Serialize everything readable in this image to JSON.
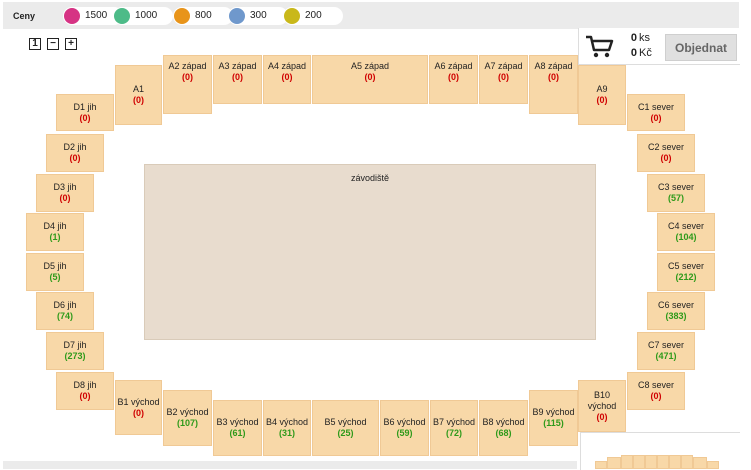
{
  "prices_title": "Ceny",
  "prices": [
    {
      "color": "#d63384",
      "value": "1500"
    },
    {
      "color": "#4dbb88",
      "value": "1000"
    },
    {
      "color": "#e8941a",
      "value": "800"
    },
    {
      "color": "#6f98cc",
      "value": "300"
    },
    {
      "color": "#c9b81a",
      "value": "200"
    }
  ],
  "zoom": {
    "reset": "1",
    "out": "−",
    "in": "+"
  },
  "cart": {
    "count": "0",
    "count_unit": "ks",
    "total": "0",
    "total_unit": "Kč",
    "order_label": "Objednat"
  },
  "field_label": "závodiště",
  "sectors": {
    "A1": {
      "name": "A1",
      "count": "(0)"
    },
    "A2": {
      "name": "A2 západ",
      "count": "(0)"
    },
    "A3": {
      "name": "A3 západ",
      "count": "(0)"
    },
    "A4": {
      "name": "A4 západ",
      "count": "(0)"
    },
    "A5": {
      "name": "A5 západ",
      "count": "(0)"
    },
    "A6": {
      "name": "A6 západ",
      "count": "(0)"
    },
    "A7": {
      "name": "A7 západ",
      "count": "(0)"
    },
    "A8": {
      "name": "A8 západ",
      "count": "(0)"
    },
    "A9": {
      "name": "A9",
      "count": "(0)"
    },
    "D1": {
      "name": "D1 jih",
      "count": "(0)"
    },
    "D2": {
      "name": "D2 jih",
      "count": "(0)"
    },
    "D3": {
      "name": "D3 jih",
      "count": "(0)"
    },
    "D4": {
      "name": "D4 jih",
      "count": "(1)"
    },
    "D5": {
      "name": "D5 jih",
      "count": "(5)"
    },
    "D6": {
      "name": "D6 jih",
      "count": "(74)"
    },
    "D7": {
      "name": "D7 jih",
      "count": "(273)"
    },
    "D8": {
      "name": "D8 jih",
      "count": "(0)"
    },
    "C1": {
      "name": "C1 sever",
      "count": "(0)"
    },
    "C2": {
      "name": "C2 sever",
      "count": "(0)"
    },
    "C3": {
      "name": "C3 sever",
      "count": "(57)"
    },
    "C4": {
      "name": "C4 sever",
      "count": "(104)"
    },
    "C5": {
      "name": "C5 sever",
      "count": "(212)"
    },
    "C6": {
      "name": "C6 sever",
      "count": "(383)"
    },
    "C7": {
      "name": "C7 sever",
      "count": "(471)"
    },
    "C8": {
      "name": "C8 sever",
      "count": "(0)"
    },
    "B1": {
      "name": "B1 východ",
      "count": "(0)"
    },
    "B2": {
      "name": "B2 východ",
      "count": "(107)"
    },
    "B3": {
      "name": "B3 východ",
      "count": "(61)"
    },
    "B4": {
      "name": "B4 východ",
      "count": "(31)"
    },
    "B5": {
      "name": "B5 východ",
      "count": "(25)"
    },
    "B6": {
      "name": "B6 východ",
      "count": "(59)"
    },
    "B7": {
      "name": "B7 východ",
      "count": "(72)"
    },
    "B8": {
      "name": "B8 východ",
      "count": "(68)"
    },
    "B9": {
      "name": "B9 východ",
      "count": "(115)"
    },
    "B10": {
      "name": "B10 východ",
      "count": "(0)"
    }
  }
}
